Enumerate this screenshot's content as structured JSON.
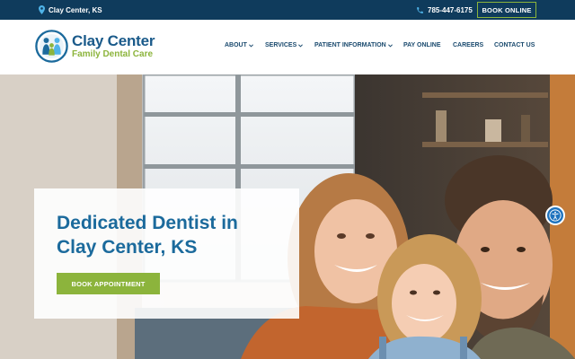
{
  "topbar": {
    "location": "Clay Center, KS",
    "phone": "785-447-6175",
    "book_online": "BOOK ONLINE"
  },
  "logo": {
    "title": "Clay Center",
    "subtitle": "Family Dental Care"
  },
  "nav": {
    "items": [
      {
        "label": "ABOUT",
        "dropdown": true
      },
      {
        "label": "SERVICES",
        "dropdown": true
      },
      {
        "label": "PATIENT INFORMATION",
        "dropdown": true
      },
      {
        "label": "PAY ONLINE",
        "dropdown": false
      },
      {
        "label": "CAREERS",
        "dropdown": false
      },
      {
        "label": "CONTACT US",
        "dropdown": false
      }
    ]
  },
  "hero": {
    "title": "Dedicated Dentist in Clay Center, KS",
    "cta": "BOOK APPOINTMENT"
  },
  "colors": {
    "navy": "#0f3b5c",
    "brand_blue": "#1b6a9c",
    "brand_green": "#8cb43c",
    "accessibility": "#1e73be"
  }
}
